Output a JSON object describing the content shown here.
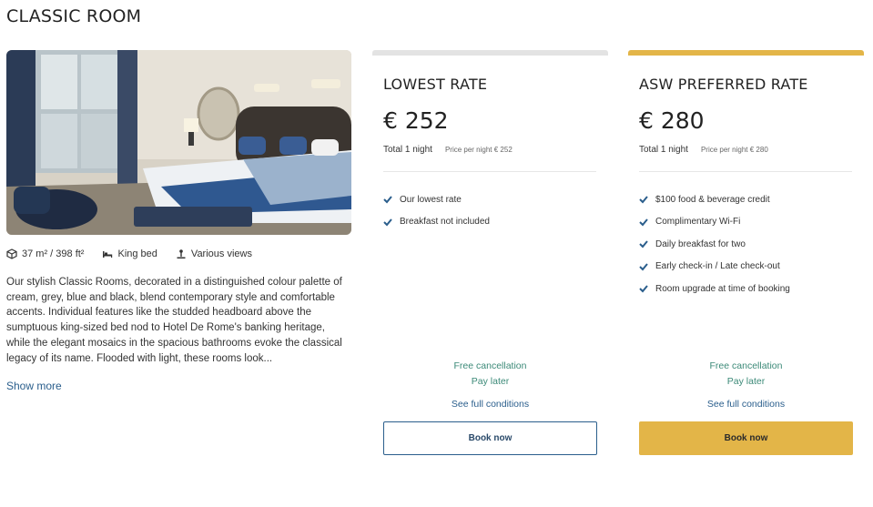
{
  "room": {
    "title": "CLASSIC ROOM",
    "features": [
      {
        "icon": "cube-icon",
        "label": "37 m² / 398 ft²"
      },
      {
        "icon": "bed-icon",
        "label": "King bed"
      },
      {
        "icon": "view-icon",
        "label": "Various views"
      }
    ],
    "description": "Our stylish Classic Rooms, decorated in a distinguished colour palette of cream, grey, blue and black, blend contemporary style and comfortable accents. Individual features like the studded headboard above the sumptuous king-sized bed nod to Hotel De Rome's banking heritage, while the elegant mosaics in the spacious bathrooms evoke the classical legacy of its name. Flooded with light, these rooms look...",
    "show_more": "Show more"
  },
  "rates": [
    {
      "name": "LOWEST RATE",
      "price": "€ 252",
      "total": "Total 1 night",
      "per_night": "Price per night € 252",
      "benefits": [
        "Our lowest rate",
        "Breakfast not included"
      ],
      "cancellation": "Free cancellation",
      "payment": "Pay later",
      "conditions": "See full conditions",
      "book": "Book now"
    },
    {
      "name": "ASW PREFERRED RATE",
      "price": "€ 280",
      "total": "Total 1 night",
      "per_night": "Price per night € 280",
      "benefits": [
        "$100 food & beverage credit",
        "Complimentary Wi-Fi",
        "Daily breakfast for two",
        "Early check-in / Late check-out",
        "Room upgrade at time of booking"
      ],
      "cancellation": "Free cancellation",
      "payment": "Pay later",
      "conditions": "See full conditions",
      "book": "Book now"
    }
  ],
  "colors": {
    "accent_gold": "#e3b548",
    "link_blue": "#2a5e8c",
    "check_blue": "#2a5e8c",
    "green_text": "#3c8a78",
    "neutral_bar": "#e3e3e3"
  }
}
